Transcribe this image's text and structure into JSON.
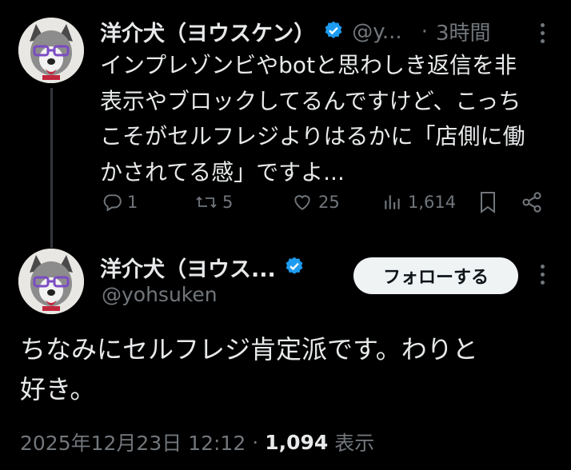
{
  "reply_tweet": {
    "display_name": "洋介犬（ヨウスケン）",
    "handle": "@y...",
    "separator": "·",
    "time": "3時間",
    "text_lines": [
      "インプレゾンビやbotと思わしき返信を非",
      "表示やブロックしてるんですけど、こっち",
      "こそがセルフレジよりはるかに「店側に働",
      "かされてる感」ですよ..."
    ],
    "actions": {
      "replies": "1",
      "reposts": "5",
      "likes": "25",
      "views": "1,614"
    }
  },
  "main_tweet": {
    "display_name": "洋介犬（ヨウス...",
    "handle": "@yohsuken",
    "follow_label": "フォローする",
    "text_lines": [
      "ちなみにセルフレジ肯定派です。わりと",
      "好き。"
    ],
    "timestamp": "2025年12月23日 12:12",
    "dot": "·",
    "view_count": "1,094",
    "view_label": "表示"
  },
  "colors": {
    "background": "#000000",
    "text": "#e7e9ea",
    "muted": "#71767b",
    "verified": "#1d9bf0",
    "follow_bg": "#eff3f4"
  }
}
